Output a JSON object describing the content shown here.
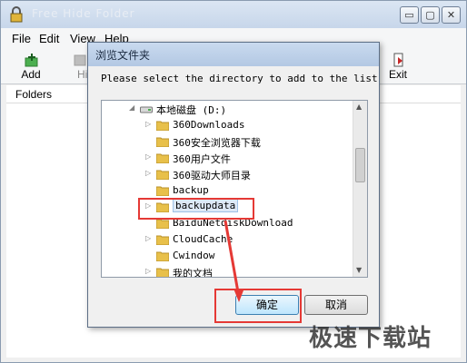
{
  "window": {
    "title": "Free Hide Folder",
    "controls": {
      "minimize": "▭",
      "maximize": "▢",
      "close": "✕"
    }
  },
  "menu": {
    "file": "File",
    "edit": "Edit",
    "view": "View",
    "help": "Help"
  },
  "toolbar": {
    "add": "Add",
    "hide_partial": "Hi",
    "exit": "Exit"
  },
  "main": {
    "folders_header": "Folders"
  },
  "dialog": {
    "title": "浏览文件夹",
    "prompt": "Please select the directory to add to the list",
    "tree": [
      {
        "label": "本地磁盘 (D:)",
        "kind": "drive",
        "expanded": true
      },
      {
        "label": "360Downloads",
        "kind": "folder"
      },
      {
        "label": "360安全浏览器下载",
        "kind": "folder"
      },
      {
        "label": "360用户文件",
        "kind": "folder"
      },
      {
        "label": "360驱动大师目录",
        "kind": "folder"
      },
      {
        "label": "backup",
        "kind": "folder"
      },
      {
        "label": "backupdata",
        "kind": "folder",
        "selected": true
      },
      {
        "label": "BaiduNetdiskDownload",
        "kind": "folder"
      },
      {
        "label": "CloudCache",
        "kind": "folder"
      },
      {
        "label": "Cwindow",
        "kind": "folder"
      },
      {
        "label": "我的文档",
        "kind": "folder"
      }
    ],
    "ok_label": "确定",
    "cancel_label": "取消"
  },
  "watermark": "极速下载站",
  "colors": {
    "highlight": "#e53935",
    "selection": "#dde8f6",
    "folder": "#e8c04a"
  }
}
